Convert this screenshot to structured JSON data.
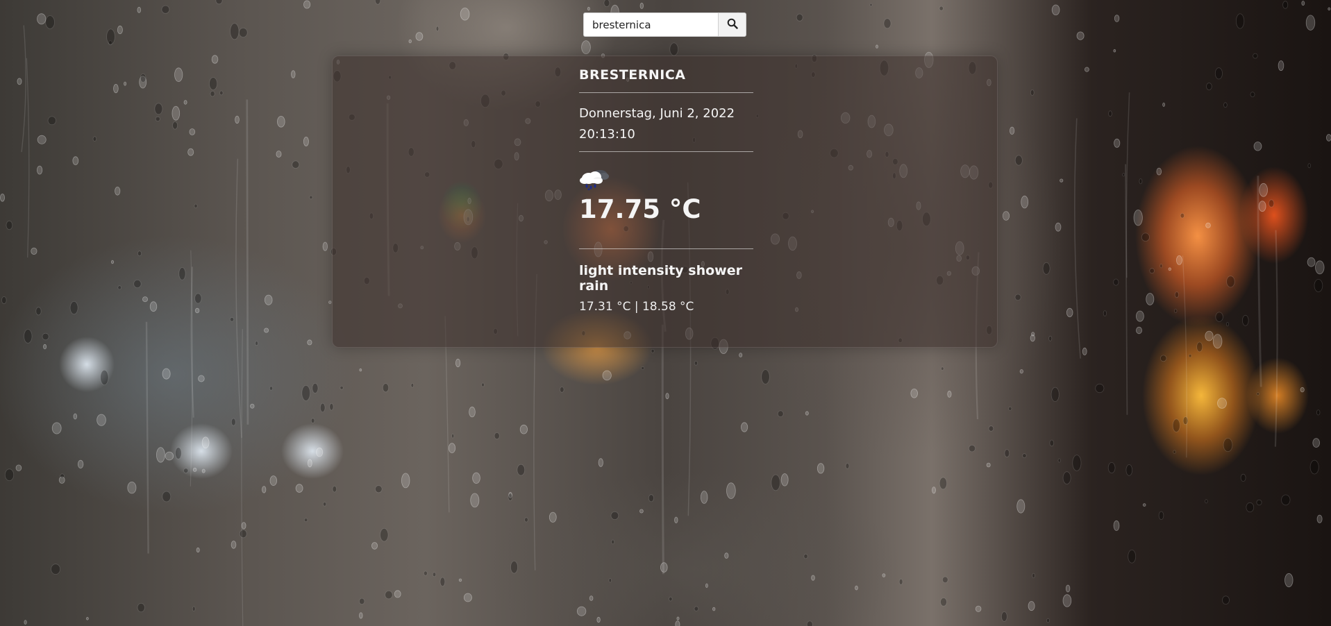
{
  "search": {
    "value": "bresternica",
    "icon": "search-icon"
  },
  "weather": {
    "city": "BRESTERNICA",
    "date": "Donnerstag, Juni 2, 2022",
    "time": "20:13:10",
    "icon": "rain-cloud-icon",
    "temperature": "17.75 °C",
    "description": "light intensity shower rain",
    "min_max": "17.31 °C | 18.58 °C"
  }
}
